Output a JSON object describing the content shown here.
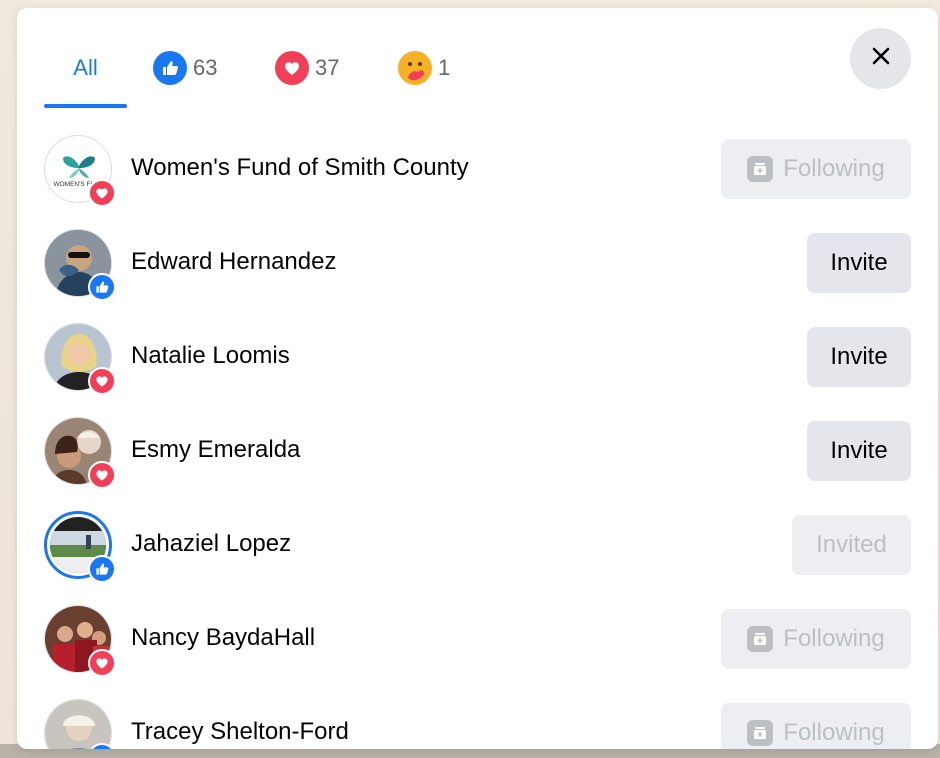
{
  "tabs": {
    "all_label": "All",
    "like_count": "63",
    "love_count": "37",
    "care_count": "1"
  },
  "colors": {
    "accent": "#1877f2",
    "love": "#f33e58",
    "care": "#f7b125",
    "button_bg": "#e4e6eb",
    "disabled_text": "#bcc0c4"
  },
  "close_icon": "close-icon",
  "people": [
    {
      "name": "Women's Fund of Smith County",
      "reaction": "love",
      "action": "Following",
      "action_state": "disabled",
      "avatar_text": "WOMEN'S FUND"
    },
    {
      "name": "Edward Hernandez",
      "reaction": "like",
      "action": "Invite",
      "action_state": "enabled"
    },
    {
      "name": "Natalie Loomis",
      "reaction": "love",
      "action": "Invite",
      "action_state": "enabled"
    },
    {
      "name": "Esmy Emeralda",
      "reaction": "love",
      "action": "Invite",
      "action_state": "enabled"
    },
    {
      "name": "Jahaziel Lopez",
      "reaction": "like",
      "action": "Invited",
      "action_state": "disabled"
    },
    {
      "name": "Nancy BaydaHall",
      "reaction": "love",
      "action": "Following",
      "action_state": "disabled"
    },
    {
      "name": "Tracey Shelton-Ford",
      "reaction": "like",
      "action": "Following",
      "action_state": "disabled"
    }
  ]
}
